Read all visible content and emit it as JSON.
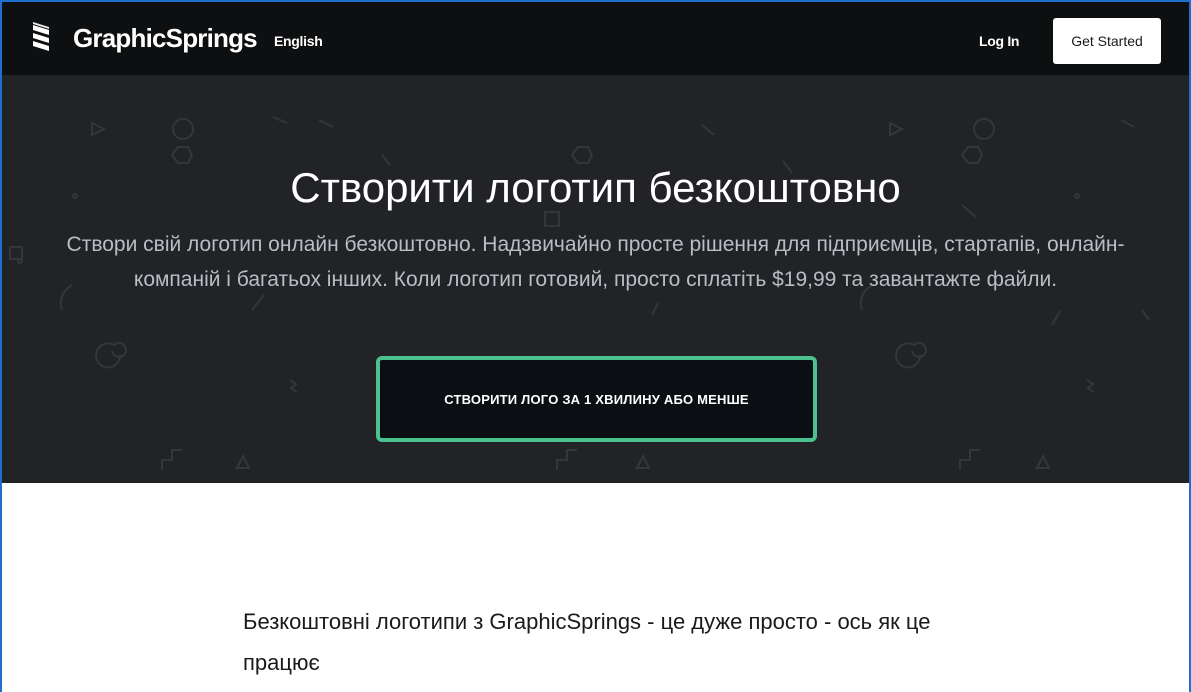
{
  "header": {
    "brand": "GraphicSprings",
    "language": "English",
    "login_label": "Log In",
    "get_started_label": "Get Started",
    "logo_icon": "graphicsprings-logo-icon"
  },
  "hero": {
    "title": "Створити логотип безкоштовно",
    "subtitle": "Створи свій логотип онлайн безкоштовно. Надзвичайно просте рішення для підприємців, стартапів, онлайн-компаній і багатьох інших. Коли логотип готовий, просто сплатіть $19,99 та завантажте файли.",
    "cta_label": "СТВОРИТИ ЛОГО ЗА 1 ХВИЛИНУ АБО МЕНШЕ",
    "cta_border_color": "#4cc08d"
  },
  "content": {
    "section_heading": "Безкоштовні логотипи з GraphicSprings - це дуже просто - ось як це працює"
  },
  "colors": {
    "header_bg": "#0e0f11",
    "hero_bg": "#222327",
    "accent": "#4cc08d"
  }
}
